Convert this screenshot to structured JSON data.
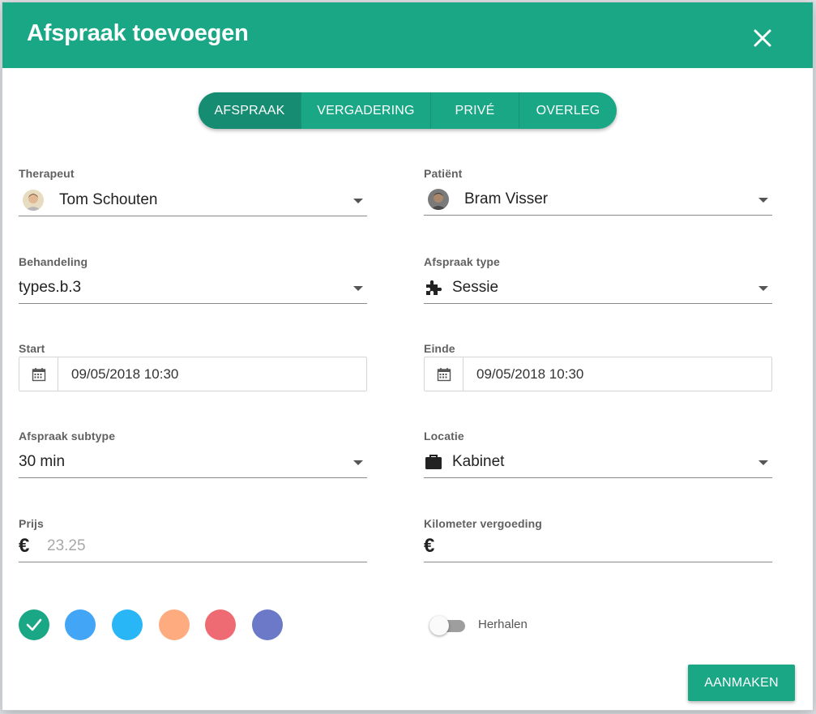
{
  "dialog": {
    "title": "Afspraak toevoegen",
    "close_icon": "close-icon"
  },
  "tabs": [
    {
      "label": "AFSPRAAK",
      "active": true
    },
    {
      "label": "VERGADERING",
      "active": false
    },
    {
      "label": "PRIVÉ",
      "active": false
    },
    {
      "label": "OVERLEG",
      "active": false
    }
  ],
  "fields": {
    "therapist": {
      "label": "Therapeut",
      "value": "Tom Schouten",
      "icon": "avatar"
    },
    "patient": {
      "label": "Patiënt",
      "value": "Bram Visser",
      "icon": "avatar"
    },
    "treatment": {
      "label": "Behandeling",
      "value": "types.b.3"
    },
    "appointment_type": {
      "label": "Afspraak type",
      "value": "Sessie",
      "icon": "puzzle-icon"
    },
    "start": {
      "label": "Start",
      "value": "09/05/2018 10:30",
      "icon": "calendar-icon"
    },
    "end": {
      "label": "Einde",
      "value": "09/05/2018 10:30",
      "icon": "calendar-icon"
    },
    "subtype": {
      "label": "Afspraak subtype",
      "value": "30 min"
    },
    "location": {
      "label": "Locatie",
      "value": "Kabinet",
      "icon": "briefcase-icon"
    },
    "price": {
      "label": "Prijs",
      "currency": "€",
      "placeholder": "23.25"
    },
    "mileage": {
      "label": "Kilometer vergoeding",
      "currency": "€",
      "value": ""
    }
  },
  "colors": {
    "selected_index": 0,
    "swatches": [
      "#1aa786",
      "#42a5f5",
      "#29b6f6",
      "#ffab80",
      "#ef6b73",
      "#6b79c8"
    ]
  },
  "repeat": {
    "label": "Herhalen",
    "enabled": false
  },
  "actions": {
    "submit_label": "AANMAKEN"
  },
  "theme": {
    "primary": "#1aa786"
  }
}
